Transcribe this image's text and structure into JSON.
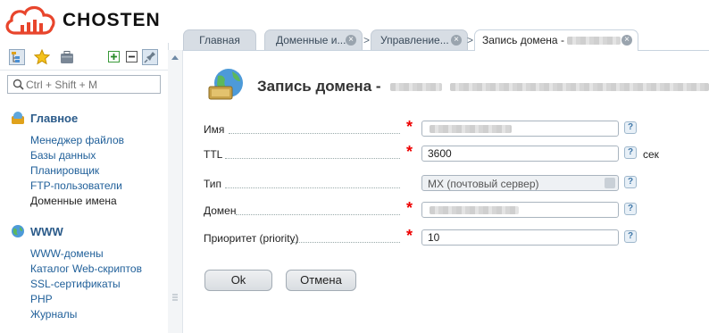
{
  "brand": {
    "name": "CHOSTEN"
  },
  "tabs": [
    {
      "label": "Главная"
    },
    {
      "label": "Доменные и..."
    },
    {
      "label": "Управление..."
    },
    {
      "label": "Запись домена -"
    }
  ],
  "sidebar": {
    "search_placeholder": "Ctrl + Shift + M",
    "groups": [
      {
        "title": "Главное",
        "items": [
          "Менеджер файлов",
          "Базы данных",
          "Планировщик",
          "FTP-пользователи",
          "Доменные имена"
        ]
      },
      {
        "title": "WWW",
        "items": [
          "WWW-домены",
          "Каталог Web-скриптов",
          "SSL-сертификаты",
          "PHP",
          "Журналы"
        ]
      }
    ]
  },
  "page": {
    "title": "Запись домена -",
    "fields": {
      "name_label": "Имя",
      "name_value": "",
      "ttl_label": "TTL",
      "ttl_value": "3600",
      "ttl_unit": "сек",
      "type_label": "Тип",
      "type_value": "MX (почтовый сервер)",
      "domain_label": "Домен",
      "domain_value": "",
      "priority_label": "Приоритет (priority)",
      "priority_value": "10"
    },
    "ok_label": "Ok",
    "cancel_label": "Отмена"
  },
  "colors": {
    "accent": "#1f5f99",
    "required": "#e00000",
    "logo": "#e8452c"
  }
}
